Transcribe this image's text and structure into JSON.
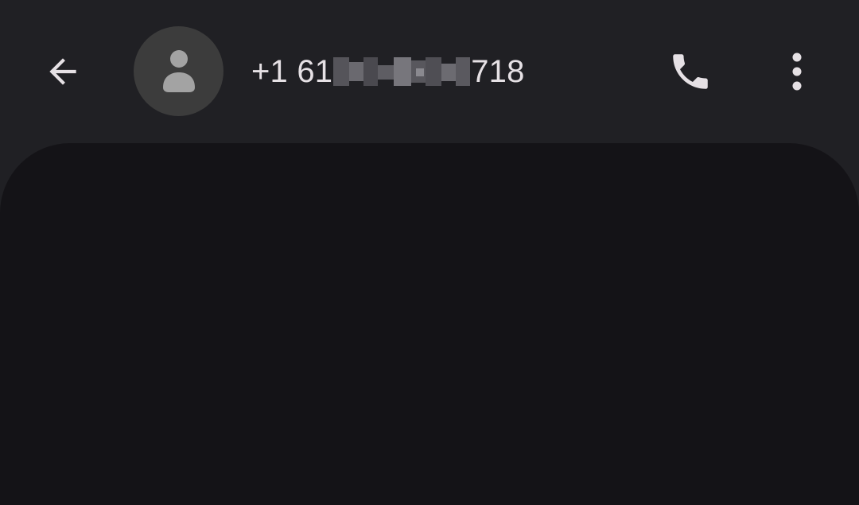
{
  "header": {
    "back_icon": "arrow-back-icon",
    "avatar_icon": "person-icon",
    "contact_number_prefix": "+1 61",
    "contact_number_suffix": "718",
    "call_icon": "phone-icon",
    "more_icon": "more-vert-icon"
  },
  "colors": {
    "app_bar_background": "#202024",
    "conversation_background": "#141317",
    "avatar_background": "#3c3c3c",
    "avatar_glyph": "#a3a3a3",
    "text_primary": "#e6e1e5",
    "icon_color": "#e6e1e5"
  }
}
